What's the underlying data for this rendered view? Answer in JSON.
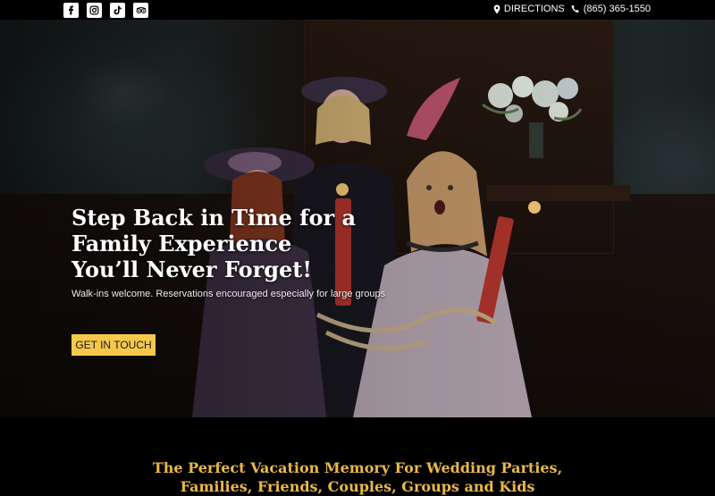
{
  "topbar": {
    "social": [
      {
        "icon": "facebook-icon"
      },
      {
        "icon": "instagram-icon"
      },
      {
        "icon": "tiktok-icon"
      },
      {
        "icon": "tripadvisor-icon"
      }
    ],
    "directions_label": "DIRECTIONS",
    "phone": "(865) 365-1550"
  },
  "hero": {
    "headline_lines": [
      "Step Back in Time for a",
      "Family Experience",
      "You’ll Never Forget!"
    ],
    "subline": "Walk-ins welcome. Reservations encouraged especially for large groups",
    "cta_label": "GET IN TOUCH"
  },
  "tagline": {
    "line1": "The Perfect Vacation Memory For Wedding Parties,",
    "line2": "Families, Friends, Couples, Groups and Kids"
  },
  "colors": {
    "accent": "#f5c84c",
    "tagline": "#e8b84a",
    "background": "#000000"
  }
}
